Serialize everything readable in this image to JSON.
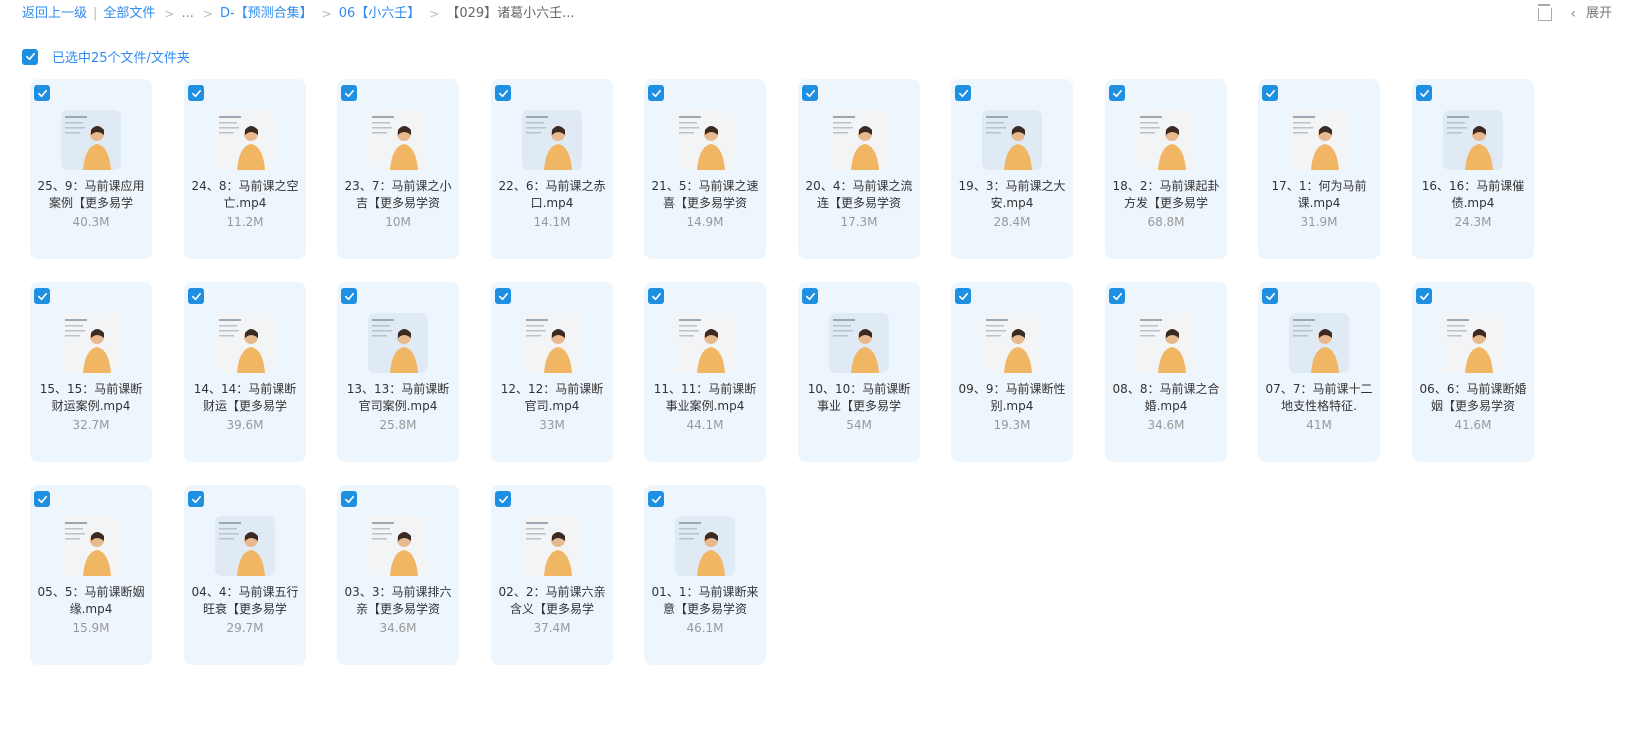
{
  "breadcrumb": {
    "back": "返回上一级",
    "sep": "|",
    "all_files": "全部文件",
    "ellipsis": "...",
    "level1": "D-【预测合集】",
    "level2": "06【小六壬】",
    "current": "【029】诸葛小六壬..."
  },
  "toolbar": {
    "view_icon": "layout-icon",
    "expand_label": "展开"
  },
  "selection": {
    "text": "已选中25个文件/文件夹"
  },
  "colors": {
    "accent": "#2f8cf0",
    "checkbox": "#1e8fe1",
    "card_bg": "#eef6fd"
  },
  "files": [
    {
      "name": "25、9：马前课应用案例【更多易学",
      "size": "40.3M"
    },
    {
      "name": "24、8：马前课之空亡.mp4",
      "size": "11.2M"
    },
    {
      "name": "23、7：马前课之小吉【更多易学资",
      "size": "10M"
    },
    {
      "name": "22、6：马前课之赤口.mp4",
      "size": "14.1M"
    },
    {
      "name": "21、5：马前课之速喜【更多易学资",
      "size": "14.9M"
    },
    {
      "name": "20、4：马前课之流连【更多易学资",
      "size": "17.3M"
    },
    {
      "name": "19、3：马前课之大安.mp4",
      "size": "28.4M"
    },
    {
      "name": "18、2：马前课起卦方发【更多易学",
      "size": "68.8M"
    },
    {
      "name": "17、1：何为马前课.mp4",
      "size": "31.9M"
    },
    {
      "name": "16、16：马前课催债.mp4",
      "size": "24.3M"
    },
    {
      "name": "15、15：马前课断财运案例.mp4",
      "size": "32.7M"
    },
    {
      "name": "14、14：马前课断财运【更多易学",
      "size": "39.6M"
    },
    {
      "name": "13、13：马前课断官司案例.mp4",
      "size": "25.8M"
    },
    {
      "name": "12、12：马前课断官司.mp4",
      "size": "33M"
    },
    {
      "name": "11、11：马前课断事业案例.mp4",
      "size": "44.1M"
    },
    {
      "name": "10、10：马前课断事业【更多易学",
      "size": "54M"
    },
    {
      "name": "09、9：马前课断性别.mp4",
      "size": "19.3M"
    },
    {
      "name": "08、8：马前课之合婚.mp4",
      "size": "34.6M"
    },
    {
      "name": "07、7：马前课十二地支性格特征.",
      "size": "41M"
    },
    {
      "name": "06、6：马前课断婚姻【更多易学资",
      "size": "41.6M"
    },
    {
      "name": "05、5：马前课断姻缘.mp4",
      "size": "15.9M"
    },
    {
      "name": "04、4：马前课五行旺衰【更多易学",
      "size": "29.7M"
    },
    {
      "name": "03、3：马前课排六亲【更多易学资",
      "size": "34.6M"
    },
    {
      "name": "02、2：马前课六亲含义【更多易学",
      "size": "37.4M"
    },
    {
      "name": "01、1：马前课断来意【更多易学资",
      "size": "46.1M"
    }
  ]
}
